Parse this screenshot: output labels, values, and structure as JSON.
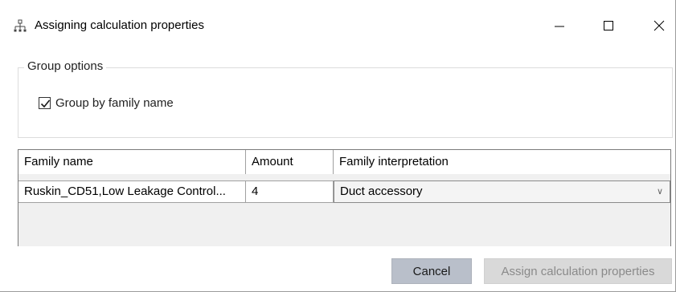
{
  "window": {
    "title": "Assigning calculation properties",
    "icon": "hierarchy-icon",
    "controls": [
      "minimize-icon",
      "maximize-icon",
      "close-icon"
    ]
  },
  "group_options": {
    "legend": "Group options",
    "group_by_family": {
      "label": "Group by family name",
      "checked": true
    }
  },
  "grid": {
    "columns": [
      "Family name",
      "Amount",
      "Family interpretation"
    ],
    "rows": [
      {
        "family_name": "Ruskin_CD51,Low Leakage Control...",
        "amount": "4",
        "interpretation": "Duct accessory"
      }
    ]
  },
  "buttons": {
    "cancel": "Cancel",
    "assign": "Assign calculation properties"
  },
  "colors": {
    "cancel_bg": "#b9bfca",
    "assign_bg_disabled": "#d9d9d9",
    "assign_text_disabled": "#8a8a8a"
  }
}
